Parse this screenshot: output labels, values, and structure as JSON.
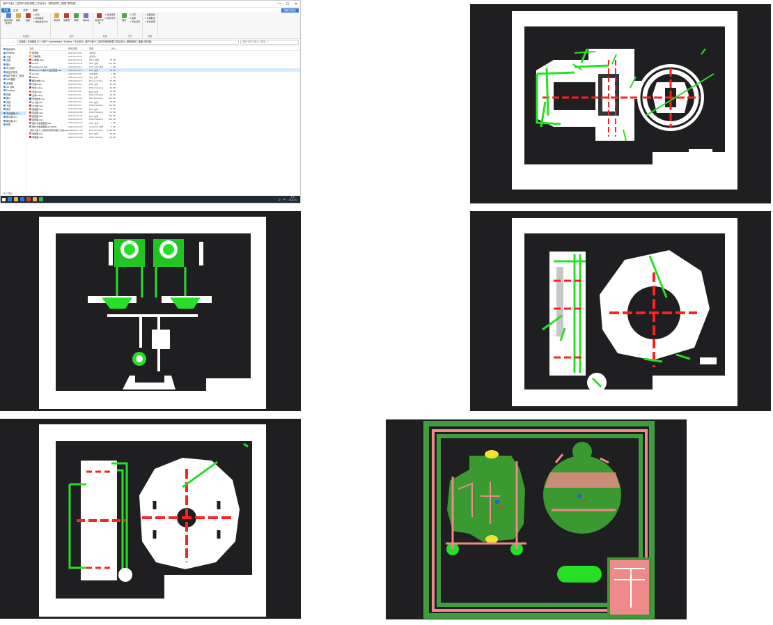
{
  "explorer": {
    "title": "保护卡盘十二腔体外壳的修整工作站设计（教程说明二维图+零件图）",
    "window_controls": [
      "—",
      "☐",
      "✕"
    ],
    "tabs": [
      "文件",
      "主页",
      "共享",
      "查看"
    ],
    "help_note": "隐藏功能区",
    "ribbon": {
      "groups": [
        {
          "name": "剪贴板",
          "items": [
            "固定到快速访问",
            "复制",
            "粘贴"
          ],
          "small": [
            "剪切",
            "复制路径",
            "粘贴快捷方式"
          ]
        },
        {
          "name": "组织",
          "items": [
            "移动到",
            "复制到",
            "删除",
            "重命名"
          ],
          "small": []
        },
        {
          "name": "新建",
          "items": [
            "新建文件夹"
          ],
          "small": [
            "新建项目",
            "轻松访问"
          ]
        },
        {
          "name": "打开",
          "items": [
            "属性"
          ],
          "small": [
            "打开",
            "编辑",
            "历史记录"
          ]
        },
        {
          "name": "选择",
          "items": [],
          "small": [
            "全部选择",
            "全部取消",
            "反向选择"
          ]
        }
      ]
    },
    "nav_buttons": [
      "←",
      "→",
      "↑"
    ],
    "address": "此电脑 › 本地磁盘 (C:) › 用户 › Administrator › Desktop › 毕业设计 › 保护卡盘十二腔体外壳的修整工作站设计（教程说明二维图+零件图）",
    "search_placeholder": "搜索\"保护卡盘十二腔体...\"",
    "nav_items": [
      "快速访问",
      "Desktop",
      "下载",
      "文档",
      "图片",
      "毕业设计",
      "新建文件夹",
      "保护卡盘十二腔体",
      "CAD图纸",
      "此电脑",
      "3D 对象",
      "Desktop",
      "视频",
      "图片",
      "文档",
      "下载",
      "音乐",
      "本地磁盘 (C:)",
      "新加卷 (D:)",
      "新加卷 (E:)",
      "网络"
    ],
    "selected_nav_index": 17,
    "columns": [
      "名称",
      "修改日期",
      "类型",
      "大小"
    ],
    "files": [
      {
        "name": "装配图",
        "date": "2021/4/2 9:08",
        "type": "文件夹",
        "size": "",
        "color": "#e8b84a"
      },
      {
        "name": "三维模型",
        "date": "2021/4/2 9:08",
        "type": "文件夹",
        "size": "",
        "color": "#e8b84a"
      },
      {
        "name": "A4图框.dwg",
        "date": "2021/3/2 10:11",
        "type": "DWG 文件",
        "size": "35 KB",
        "color": "#c0392b"
      },
      {
        "name": "A4.pdf",
        "date": "2021/3/2 10:11",
        "type": "PDF 文件",
        "size": "221 KB",
        "color": "#d63b2f"
      },
      {
        "name": "acadiso.lsp_bak",
        "date": "2021/3/4 9:44",
        "type": "LSP_BAK 文件",
        "size": "1 KB",
        "color": "#888888"
      },
      {
        "name": "Backup of 保护卡盘装配图.bak",
        "date": "2021/3/2 10:11",
        "type": "BAK 文件",
        "size": "88 KB",
        "color": "#888888"
      },
      {
        "name": "plot.log",
        "date": "2021/3/2 9:56",
        "type": "文本文档",
        "size": "1 KB",
        "color": "#aaaaaa"
      },
      {
        "name": "std.sel",
        "date": "2021/3/2 10:11",
        "type": "SEL 文件",
        "size": "1 KB",
        "color": "#888888"
      },
      {
        "name": "翻译文档.doc",
        "date": "2021/3/2 10:11",
        "type": "Microsoft Word",
        "size": "56 KB",
        "color": "#2b5797"
      },
      {
        "name": "支架1.bak",
        "date": "2021/3/2 9:40",
        "type": "BAK 文件",
        "size": "38 KB",
        "color": "#888888"
      },
      {
        "name": "支架1.dwg",
        "date": "2021/3/2 9:12",
        "type": "DWG Drawing",
        "size": "48 KB",
        "color": "#c0392b"
      },
      {
        "name": "支架2.bak",
        "date": "2021/3/2 9:11",
        "type": "BAK 文件",
        "size": "39 KB",
        "color": "#888888"
      },
      {
        "name": "支架2.dwg",
        "date": "2021/3/2 9:11",
        "type": "DWG Drawing",
        "size": "49 KB",
        "color": "#c0392b"
      },
      {
        "name": "开题报告.doc",
        "date": "2021/3/2 10:07",
        "type": "Microsoft Word",
        "size": "206 KB",
        "color": "#2b5797"
      },
      {
        "name": "大卡盘.bak",
        "date": "2021/3/2 9:10",
        "type": "BAK 文件",
        "size": "86 KB",
        "color": "#888888"
      },
      {
        "name": "大卡盘.dwg",
        "date": "2021/3/2 9:10",
        "type": "DWG Drawing",
        "size": "101 KB",
        "color": "#c0392b"
      },
      {
        "name": "底座图.bak",
        "date": "2021/3/2 10:01",
        "type": "BAK 文件",
        "size": "42 KB",
        "color": "#888888"
      },
      {
        "name": "底座图.dwg",
        "date": "2021/3/2 10:01",
        "type": "DWG Drawing",
        "size": "51 KB",
        "color": "#c0392b"
      },
      {
        "name": "装配图.bak",
        "date": "2021/3/2 10:07",
        "type": "BAK 文件",
        "size": "286 KB",
        "color": "#888888"
      },
      {
        "name": "装配图.dwg",
        "date": "2021/4/2 10:07",
        "type": "DWG Drawing",
        "size": "350 KB",
        "color": "#c0392b"
      },
      {
        "name": "保护卡盘装配图.dwl",
        "date": "2021/4/2 10:07",
        "type": "DWL 文件",
        "size": "1 KB",
        "color": "#888888"
      },
      {
        "name": "保护卡盘装配图.SCADOC",
        "date": "2021/4/2 10:07",
        "type": "SCADOC 文件",
        "size": "5 KB",
        "color": "#888888"
      },
      {
        "name": "保护卡盘十二腔体外壳的修整工作站.doc",
        "date": "2021/4/2 17:02",
        "type": "Microsoft Word",
        "size": "1,295 KB",
        "color": "#2b5797"
      },
      {
        "name": "滑板图.bak",
        "date": "2021/3/2 10:06",
        "type": "BAK 文件",
        "size": "59 KB",
        "color": "#888888"
      },
      {
        "name": "滑板图.dwg",
        "date": "2021/3/2 10:06",
        "type": "DWG Drawing",
        "size": "68 KB",
        "color": "#c0392b"
      }
    ],
    "selected_file_index": 5,
    "status": "25 个项目",
    "taskbar": {
      "icon_colors": [
        "#2e7bd6",
        "#e8b84a",
        "#3a6fd8",
        "#d83b3b",
        "#e8b84a",
        "#4caf50"
      ],
      "tray": [
        "^",
        "中",
        "🔊"
      ],
      "time": "9:17",
      "date": "2021/4/2"
    }
  },
  "drawings": [
    {
      "name": "drawing-chuck-side-front",
      "background": "#1f1f22",
      "frame": "#ffffff"
    },
    {
      "name": "drawing-bracket-assembly",
      "background": "#1f1f22",
      "frame": "#ffffff"
    },
    {
      "name": "drawing-base-plate",
      "background": "#1f1f22",
      "frame": "#ffffff"
    },
    {
      "name": "drawing-large-chuck",
      "background": "#1f1f22",
      "frame": "#ffffff"
    },
    {
      "name": "drawing-assembly-colored",
      "background": "#1f1f22",
      "frame": "#3f9c3f"
    }
  ],
  "colors": {
    "part_white": "#ffffff",
    "line_green": "#25e025",
    "center_red": "#ff2020",
    "fill_green": "#3a9a30",
    "pink": "#f08a8a",
    "yellow": "#f2e230"
  }
}
